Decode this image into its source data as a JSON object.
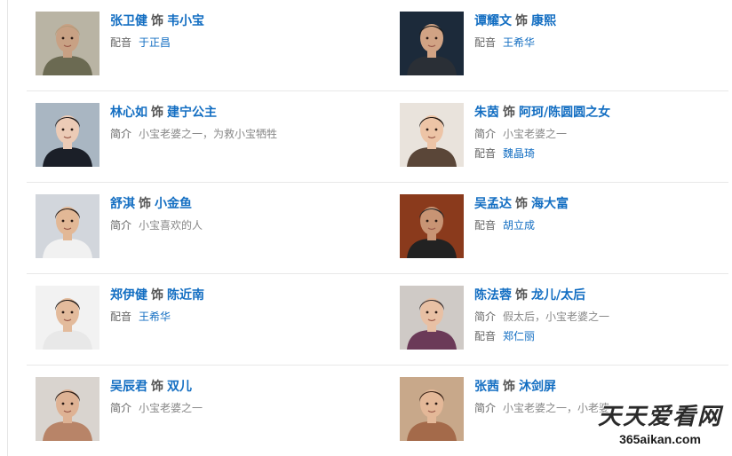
{
  "separator": "饰",
  "labels": {
    "intro": "简介",
    "dub": "配音"
  },
  "cast": [
    {
      "actor": "张卫健",
      "role": "韦小宝",
      "intro": "",
      "dub": "于正昌",
      "photo_icon": "portrait-photo",
      "bg": "#b9b4a4",
      "skin": "#c8a184",
      "hair": "#b59a7a",
      "cloth": "#6b6a52"
    },
    {
      "actor": "谭耀文",
      "role": "康熙",
      "intro": "",
      "dub": "王希华",
      "photo_icon": "portrait-photo",
      "bg": "#1c2a3a",
      "skin": "#d1a384",
      "hair": "#1a1a1a",
      "cloth": "#2a2f36"
    },
    {
      "actor": "林心如",
      "role": "建宁公主",
      "intro": "小宝老婆之一，为救小宝牺牲",
      "dub": "",
      "photo_icon": "portrait-photo",
      "bg": "#a9b6c2",
      "skin": "#eccbb6",
      "hair": "#1f1a1a",
      "cloth": "#1b1f28"
    },
    {
      "actor": "朱茵",
      "role": "阿珂/陈圆圆之女",
      "intro": "小宝老婆之一",
      "dub": "魏晶琦",
      "photo_icon": "portrait-photo",
      "bg": "#e9e3dc",
      "skin": "#edc4a6",
      "hair": "#1c1410",
      "cloth": "#5a4638"
    },
    {
      "actor": "舒淇",
      "role": "小金鱼",
      "intro": "小宝喜欢的人",
      "dub": "",
      "photo_icon": "portrait-photo",
      "bg": "#d2d6dc",
      "skin": "#e2b896",
      "hair": "#2a1e18",
      "cloth": "#f1f1f1"
    },
    {
      "actor": "吴孟达",
      "role": "海大富",
      "intro": "",
      "dub": "胡立成",
      "photo_icon": "portrait-photo",
      "bg": "#8a3a1c",
      "skin": "#c89474",
      "hair": "#2b2b2b",
      "cloth": "#222222"
    },
    {
      "actor": "郑伊健",
      "role": "陈近南",
      "intro": "",
      "dub": "王希华",
      "photo_icon": "portrait-photo",
      "bg": "#f2f2f2",
      "skin": "#e3bb9c",
      "hair": "#1e1a18",
      "cloth": "#e8e8e8"
    },
    {
      "actor": "陈法蓉",
      "role": "龙儿/太后",
      "intro": "假太后，小宝老婆之一",
      "dub": "郑仁丽",
      "photo_icon": "portrait-photo",
      "bg": "#cfcac6",
      "skin": "#e8c0a4",
      "hair": "#3a3030",
      "cloth": "#6b3a58"
    },
    {
      "actor": "吴辰君",
      "role": "双儿",
      "intro": "小宝老婆之一",
      "dub": "",
      "photo_icon": "portrait-photo",
      "bg": "#d9d4cf",
      "skin": "#deb294",
      "hair": "#2a1c16",
      "cloth": "#b88468"
    },
    {
      "actor": "张茜",
      "role": "沐剑屏",
      "intro": "小宝老婆之一，小老婆",
      "dub": "",
      "photo_icon": "portrait-photo",
      "bg": "#c8a88a",
      "skin": "#e4b898",
      "hair": "#3a2418",
      "cloth": "#a46a4a"
    }
  ],
  "watermark": {
    "title": "天天爱看网",
    "url": "365aikan.com"
  }
}
